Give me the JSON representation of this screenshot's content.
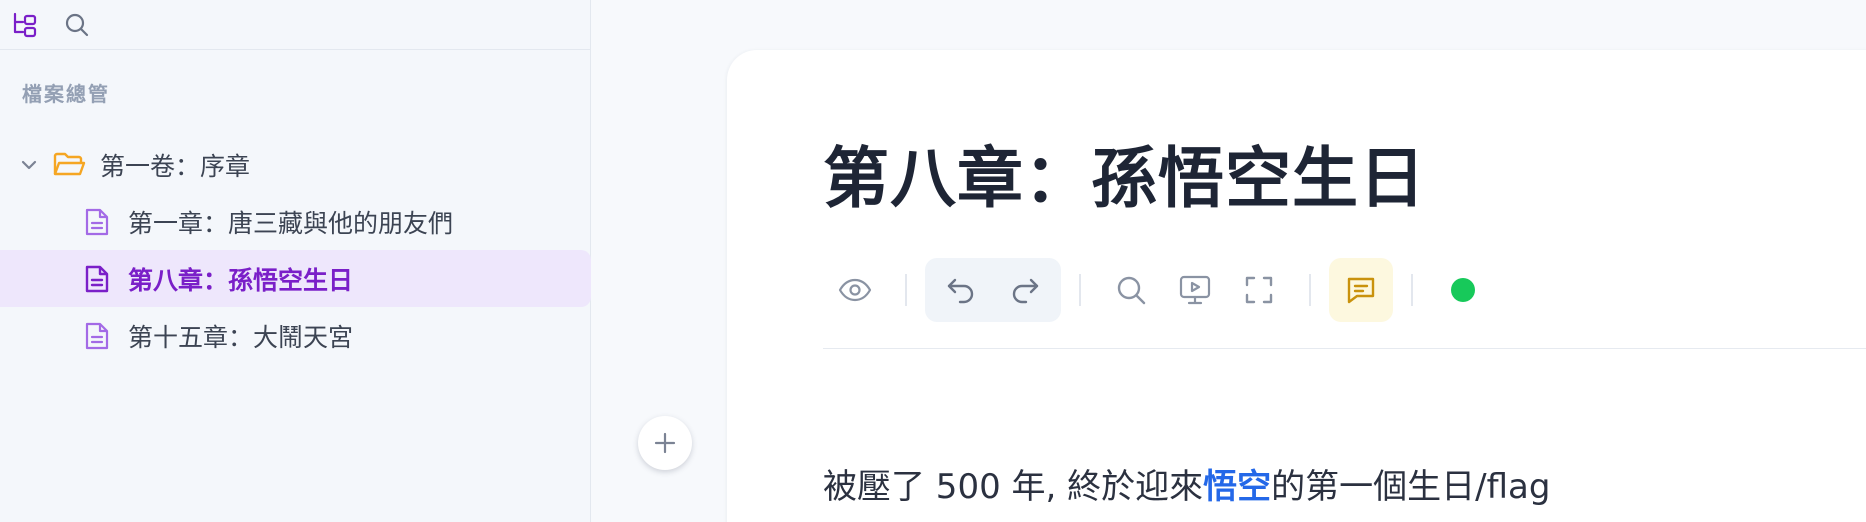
{
  "sidebar": {
    "section_title": "檔案總管",
    "tree": {
      "folder": {
        "label": "第一卷：序章",
        "expanded": true
      },
      "files": [
        {
          "label": "第一章：唐三藏與他的朋友們",
          "active": false
        },
        {
          "label": "第八章：孫悟空生日",
          "active": true
        },
        {
          "label": "第十五章：大鬧天宮",
          "active": false
        }
      ]
    }
  },
  "editor": {
    "title": "第八章：孫悟空生日",
    "body": {
      "before": "被壓了 500 年, 終於迎來",
      "highlight": "悟空",
      "after": "的第一個生日/flag"
    }
  },
  "colors": {
    "accent": "#7a1fc8",
    "folder": "#f5a623",
    "doc_icon": "#a36ae6",
    "highlight": "#2468e8",
    "comment": "#c9920d",
    "status": "#17c95a"
  }
}
